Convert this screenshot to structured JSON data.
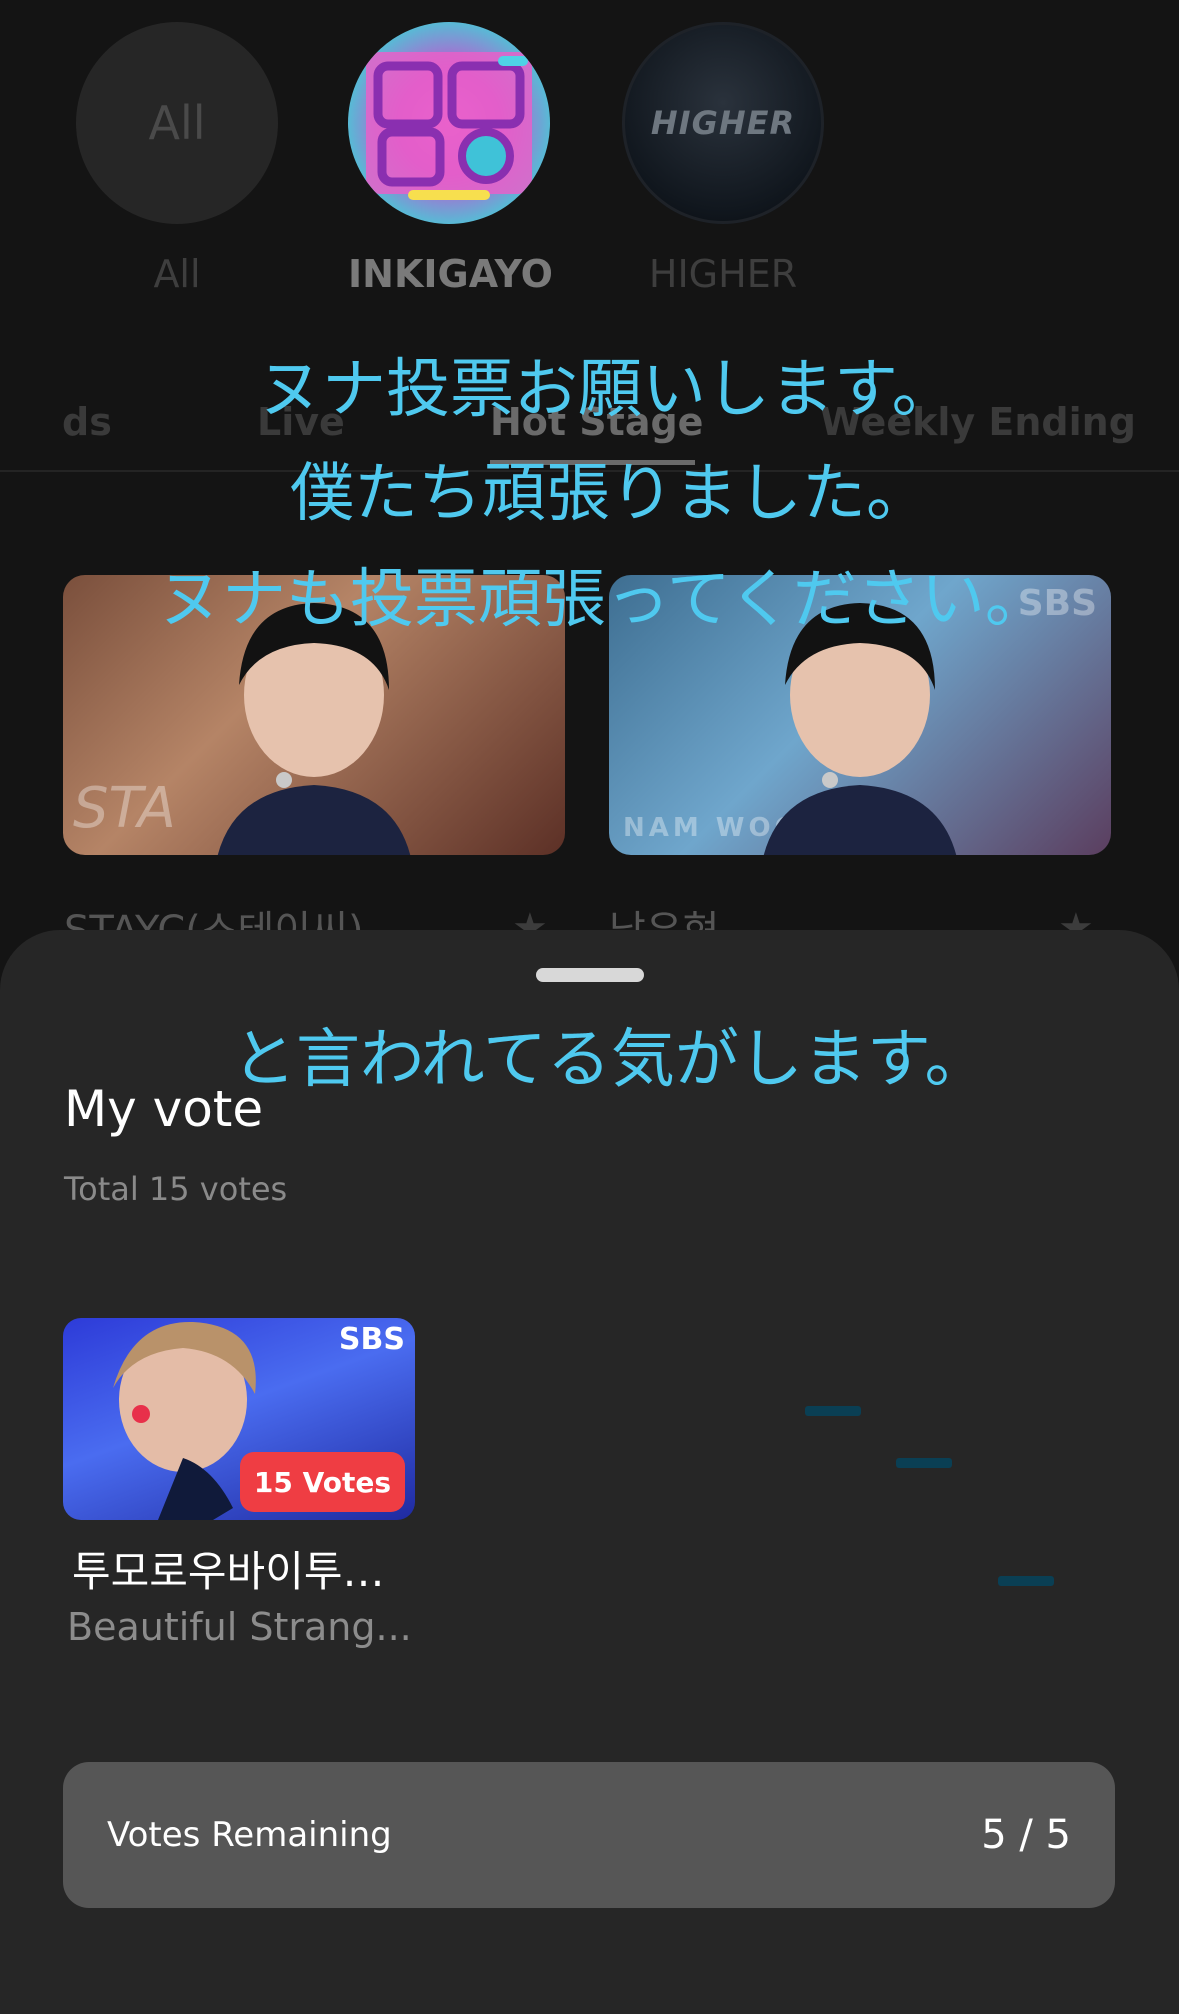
{
  "channels": [
    {
      "label": "All",
      "circle_text": "All",
      "active": false
    },
    {
      "label": "INKIGAYO",
      "active": true
    },
    {
      "label": "HIGHER",
      "circle_text": "HIGHER",
      "active": false
    }
  ],
  "tabs": [
    {
      "label": "ds",
      "active": false
    },
    {
      "label": "Live",
      "active": false
    },
    {
      "label": "Hot Stage",
      "active": true
    },
    {
      "label": "Weekly Ending",
      "active": false
    }
  ],
  "cards": [
    {
      "title": "STAYC(스테이씨)",
      "watermark": "STA"
    },
    {
      "title": "남우현",
      "watermark": "NAM WOO HYU",
      "logo": "SBS"
    }
  ],
  "captions": {
    "line1": "ヌナ投票お願いします。",
    "line2": "僕たち頑張りました。",
    "line3": "ヌナも投票頑張ってください。",
    "line4": "と言われてる気がします。"
  },
  "sheet": {
    "title": "My vote",
    "total": "Total 15 votes",
    "item": {
      "logo": "SBS",
      "badge": "15 Votes",
      "artist": "투모로우바이투…",
      "song": "Beautiful Strang..."
    },
    "remaining_label": "Votes Remaining",
    "remaining_value": "5 / 5"
  },
  "colors": {
    "caption": "#4fc9ef",
    "badge": "#ef3d43",
    "sheet_bg": "#262626"
  }
}
